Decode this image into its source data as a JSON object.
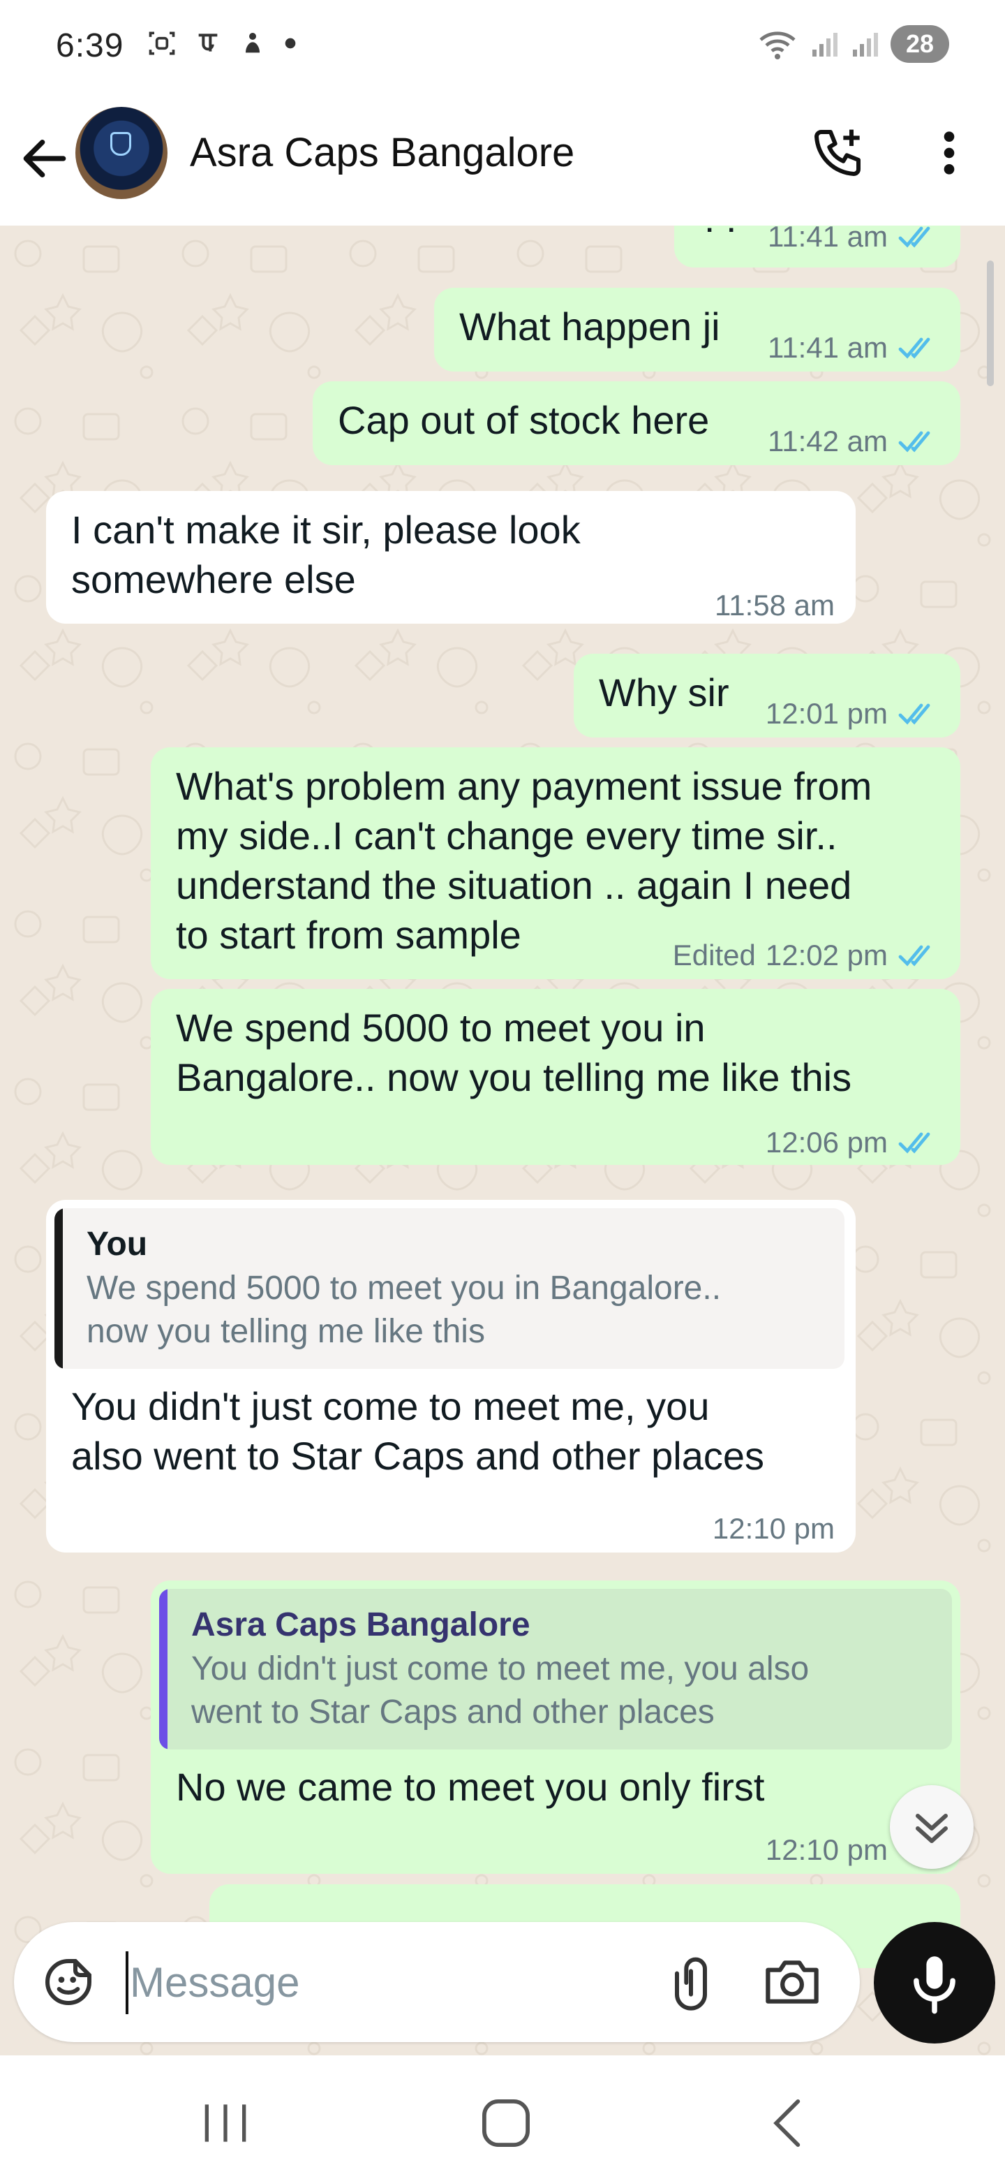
{
  "status_bar": {
    "time": "6:39",
    "left_icons": [
      "screenshot-icon",
      "payment-app-icon",
      "notification-app-icon",
      "dot-icon"
    ],
    "battery": "28"
  },
  "header": {
    "contact_name": "Asra Caps Bangalore",
    "avatar": "cap-photo"
  },
  "messages": [
    {
      "dir": "out",
      "text": "??",
      "time": "11:41 am",
      "status": "read"
    },
    {
      "dir": "out",
      "text": "What happen ji",
      "time": "11:41 am",
      "status": "read"
    },
    {
      "dir": "out",
      "text": "Cap out of stock here",
      "time": "11:42 am",
      "status": "read"
    },
    {
      "dir": "in",
      "text": "I can't make it sir, please look\nsomewhere else",
      "time": "11:58 am"
    },
    {
      "dir": "out",
      "text": "Why sir",
      "time": "12:01 pm",
      "status": "read"
    },
    {
      "dir": "out",
      "text": "What's problem any payment issue from\nmy side..I can't change every time sir..\nunderstand the situation .. again I need\nto start from sample",
      "edited_label": "Edited",
      "time": "12:02 pm",
      "status": "read"
    },
    {
      "dir": "out",
      "text": "We spend 5000 to meet you in\nBangalore.. now you telling me like this",
      "time": "12:06 pm",
      "status": "read"
    },
    {
      "dir": "in",
      "quote_name": "You",
      "quote_text": "We spend 5000 to meet you in Bangalore..\nnow you telling me like this",
      "text": "You didn't just come to meet me, you\nalso went to Star Caps and other places",
      "time": "12:10 pm"
    },
    {
      "dir": "out",
      "quote_name": "Asra Caps Bangalore",
      "quote_text": "You didn't just come to meet me, you also\nwent to Star Caps and other places",
      "text": "No we came to meet you only first",
      "time": "12:10 pm",
      "status": "read"
    }
  ],
  "input": {
    "placeholder": "Message"
  },
  "colors": {
    "outgoing_bubble": "#d9fdd3",
    "incoming_bubble": "#ffffff",
    "chat_background": "#efe7dd",
    "read_ticks": "#53bdeb",
    "quote_bar_you": "#1a1a1a",
    "quote_bar_contact": "#6c4ee6",
    "quote_name_contact": "#35336f"
  }
}
